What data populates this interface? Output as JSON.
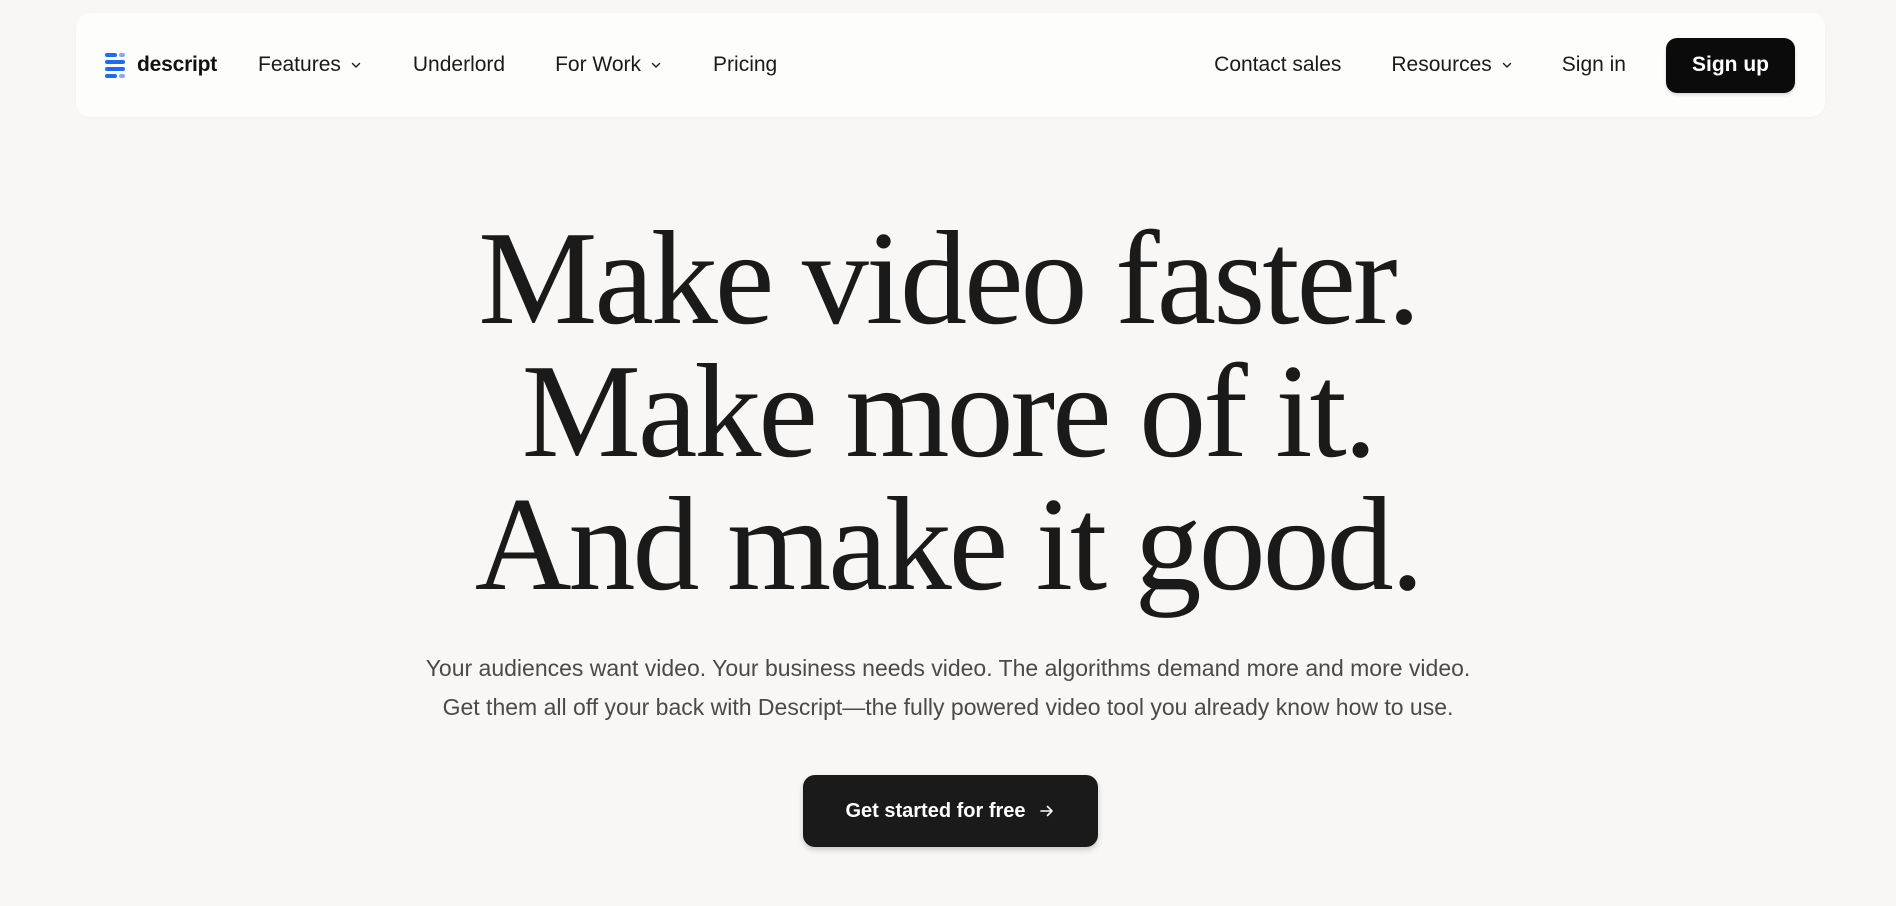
{
  "nav": {
    "logo_text": "descript",
    "logo_icon": "descript-logo-icon",
    "brand_color": "#1e6cf0",
    "left_items": [
      {
        "label": "Features",
        "has_dropdown": true
      },
      {
        "label": "Underlord",
        "has_dropdown": false
      },
      {
        "label": "For Work",
        "has_dropdown": true
      },
      {
        "label": "Pricing",
        "has_dropdown": false
      }
    ],
    "right_items": [
      {
        "label": "Contact sales",
        "has_dropdown": false
      },
      {
        "label": "Resources",
        "has_dropdown": true
      },
      {
        "label": "Sign in",
        "has_dropdown": false
      }
    ],
    "signup_label": "Sign up"
  },
  "hero": {
    "title_lines": [
      "Make video faster.",
      "Make more of it.",
      "And make it good."
    ],
    "subtitle_lines": [
      "Your audiences want video. Your business needs video. The algorithms demand more and more video.",
      "Get them all off your back with Descript—the fully powered video tool you already know how to use."
    ],
    "cta_label": "Get started for free",
    "cta_icon": "arrow-right-icon"
  }
}
